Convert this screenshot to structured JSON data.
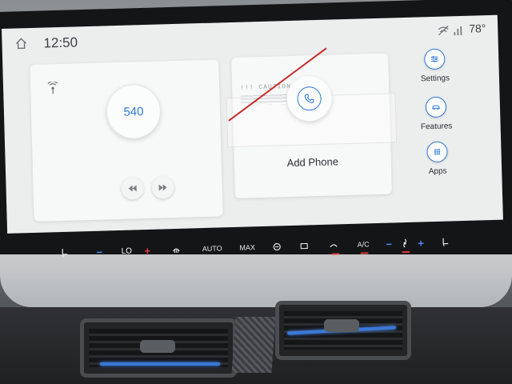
{
  "status_bar": {
    "time": "12:50",
    "outside_temp": "78°",
    "icons": [
      "home-icon",
      "wifi-off-icon",
      "signal-icon"
    ]
  },
  "radio_card": {
    "icon": "radio-signal-icon",
    "frequency": "540",
    "controls": [
      "seek-back-icon",
      "seek-forward-icon"
    ]
  },
  "phone_card": {
    "icon": "phone-icon",
    "label": "Add Phone",
    "sticker_text": "!!! CAUTION !!!"
  },
  "side_apps": [
    {
      "label": "Settings",
      "icon": "sliders-icon"
    },
    {
      "label": "Features",
      "icon": "car-icon"
    },
    {
      "label": "Apps",
      "icon": "grid-icon"
    }
  ],
  "climate": {
    "driver_temp": "LO",
    "auto_label": "AUTO",
    "max_label": "MAX",
    "ac_label": "A/C",
    "minus": "−",
    "plus": "+"
  },
  "colors": {
    "accent": "#2f7ad8",
    "heat": "#e53a3a",
    "vent_light": "#3b78d8"
  }
}
